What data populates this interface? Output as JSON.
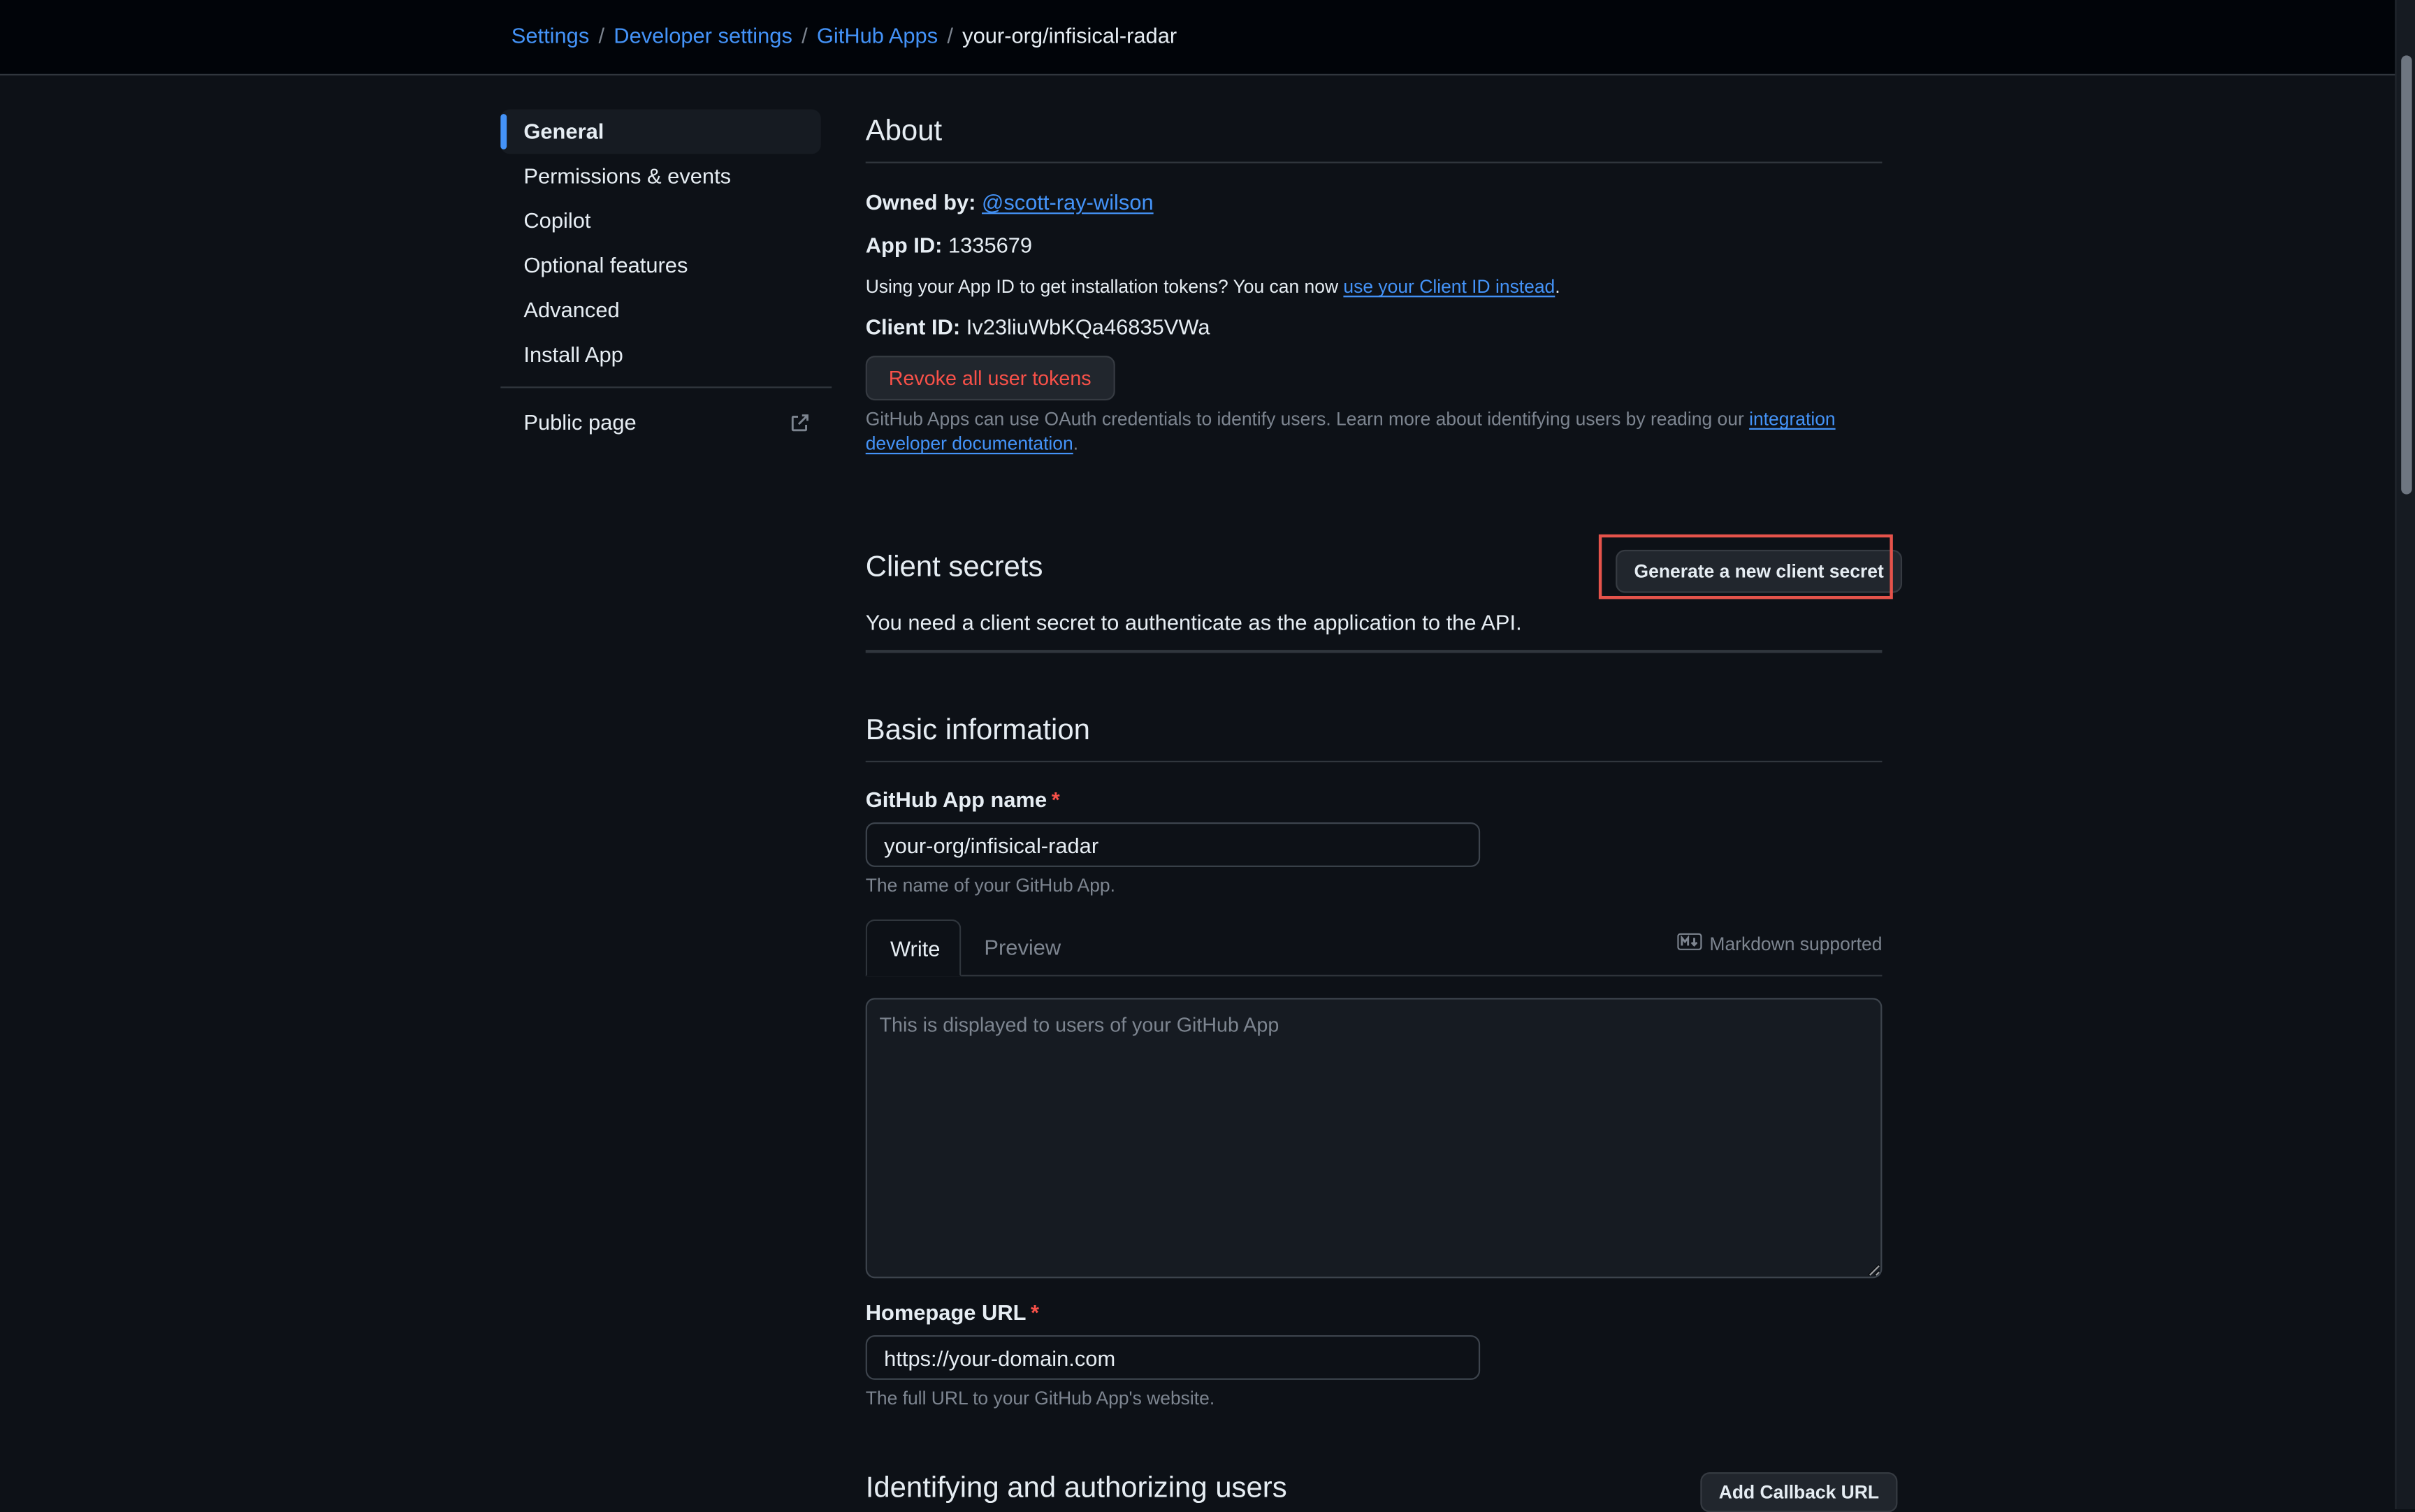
{
  "breadcrumb": {
    "items": [
      "Settings",
      "Developer settings",
      "GitHub Apps"
    ],
    "separator": "/",
    "current": "your-org/infisical-radar"
  },
  "sidebar": {
    "items": [
      {
        "label": "General",
        "active": true
      },
      {
        "label": "Permissions & events",
        "active": false
      },
      {
        "label": "Copilot",
        "active": false
      },
      {
        "label": "Optional features",
        "active": false
      },
      {
        "label": "Advanced",
        "active": false
      },
      {
        "label": "Install App",
        "active": false
      }
    ],
    "public_page": {
      "label": "Public page",
      "icon": "link-external-icon"
    }
  },
  "about": {
    "title": "About",
    "owned_by_label": "Owned by:",
    "owner": "@scott-ray-wilson",
    "app_id_label": "App ID:",
    "app_id": "1335679",
    "app_id_note_prefix": "Using your App ID to get installation tokens? You can now ",
    "app_id_note_link": "use your Client ID instead",
    "app_id_note_suffix": ".",
    "client_id_label": "Client ID:",
    "client_id": "Iv23liuWbKQa46835VWa",
    "revoke_button": "Revoke all user tokens",
    "oauth_note_prefix": "GitHub Apps can use OAuth credentials to identify users. Learn more about identifying users by reading our ",
    "oauth_note_link": "integration developer documentation",
    "oauth_note_suffix": "."
  },
  "client_secrets": {
    "title": "Client secrets",
    "generate_button": "Generate a new client secret",
    "description": "You need a client secret to authenticate as the application to the API."
  },
  "basic_info": {
    "title": "Basic information",
    "app_name_label": "GitHub App name",
    "required_mark": "*",
    "app_name_value": "your-org/infisical-radar",
    "app_name_help": "The name of your GitHub App.",
    "tabs": [
      "Write",
      "Preview"
    ],
    "markdown_hint": "Markdown supported",
    "description_placeholder": "This is displayed to users of your GitHub App",
    "homepage_label": "Homepage URL",
    "homepage_value": "https://your-domain.com",
    "homepage_help": "The full URL to your GitHub App's website."
  },
  "identifying": {
    "title": "Identifying and authorizing users",
    "add_callback_button": "Add Callback URL"
  },
  "colors": {
    "background": "#0d1117",
    "accent": "#4493f8",
    "danger": "#f85149",
    "highlight": "#e5534b"
  }
}
